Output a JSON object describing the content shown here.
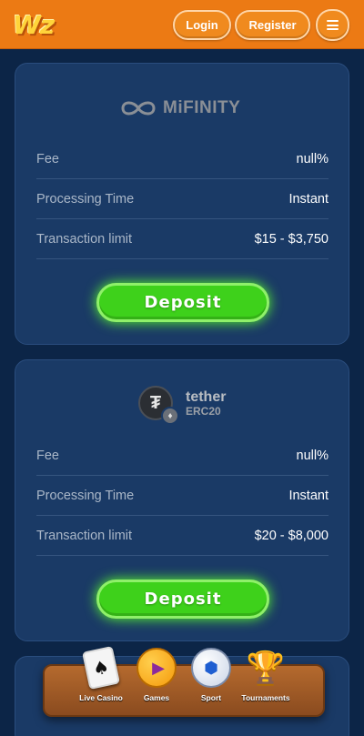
{
  "header": {
    "logo": "Wz",
    "login_label": "Login",
    "register_label": "Register",
    "menu_icon": "hamburger-icon"
  },
  "cards": [
    {
      "brand": {
        "name": "MiFINITY",
        "icon": "infinity-logo-icon"
      },
      "rows": [
        {
          "label": "Fee",
          "value": "null%"
        },
        {
          "label": "Processing Time",
          "value": "Instant"
        },
        {
          "label": "Transaction limit",
          "value": "$15 - $3,750"
        }
      ],
      "deposit_label": "Deposit"
    },
    {
      "brand": {
        "name": "tether",
        "sub": "ERC20",
        "coin_glyph": "₮",
        "badge_glyph": "♦",
        "icon": "tether-coin-icon"
      },
      "rows": [
        {
          "label": "Fee",
          "value": "null%"
        },
        {
          "label": "Processing Time",
          "value": "Instant"
        },
        {
          "label": "Transaction limit",
          "value": "$20 - $8,000"
        }
      ],
      "deposit_label": "Deposit"
    }
  ],
  "bottom_nav": [
    {
      "label": "Live Casino",
      "icon": "playing-card-icon"
    },
    {
      "label": "Games",
      "icon": "play-icon"
    },
    {
      "label": "Sport",
      "icon": "soccer-ball-icon"
    },
    {
      "label": "Tournaments",
      "icon": "trophy-icon"
    }
  ],
  "colors": {
    "header_bg": "#ec7a14",
    "page_bg": "#0c2547",
    "card_bg": "#1a3a66",
    "deposit_green": "#3ed11b"
  }
}
